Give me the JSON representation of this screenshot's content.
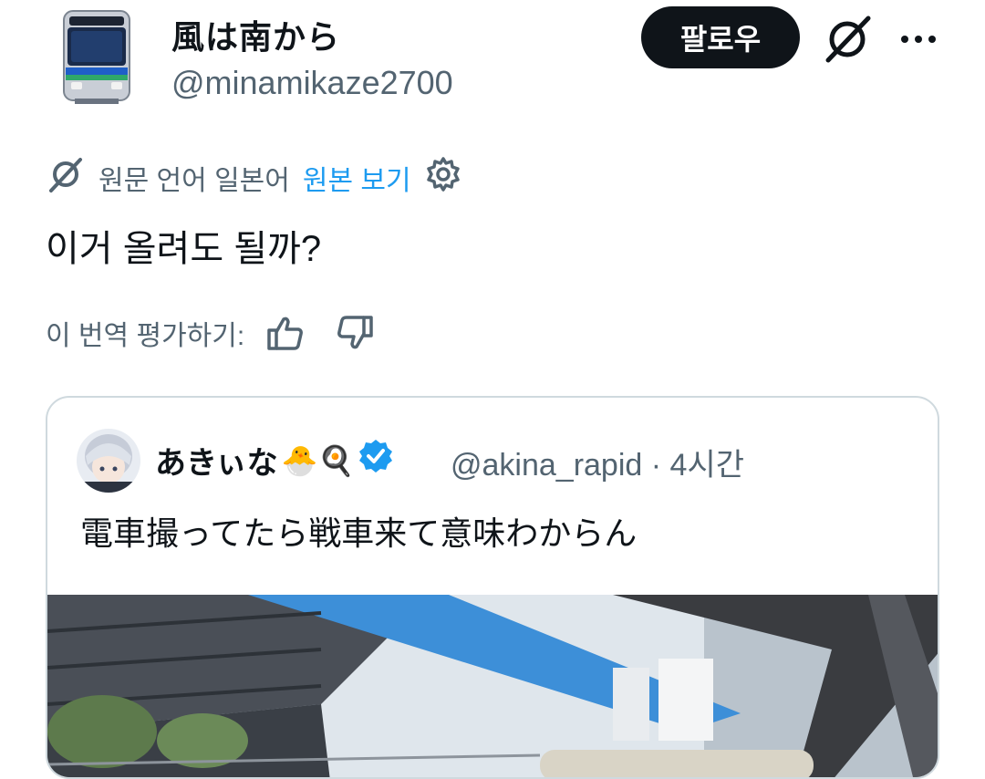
{
  "author": {
    "display_name": "風は南から",
    "handle": "@minamikaze2700",
    "avatar_icon": "train-avatar"
  },
  "header": {
    "follow_label": "팔로우",
    "grok_icon": "grok-icon",
    "more_icon": "more-icon"
  },
  "translation": {
    "source_text": "원문 언어 일본어",
    "view_original": "원본 보기",
    "settings_icon": "gear-icon"
  },
  "tweet": {
    "text": "이거 올려도 될까?"
  },
  "rating": {
    "label": "이 번역 평가하기:"
  },
  "quote": {
    "display_name": "あきぃな",
    "emojis": "🐣🍳",
    "handle": "@akina_rapid",
    "time": "· 4시간",
    "text": "電車撮ってたら戦車来て意味わからん"
  },
  "colors": {
    "accent": "#1d9bf0",
    "secondary_text": "#536471",
    "primary_text": "#0f1419",
    "border": "#cfd9de"
  }
}
